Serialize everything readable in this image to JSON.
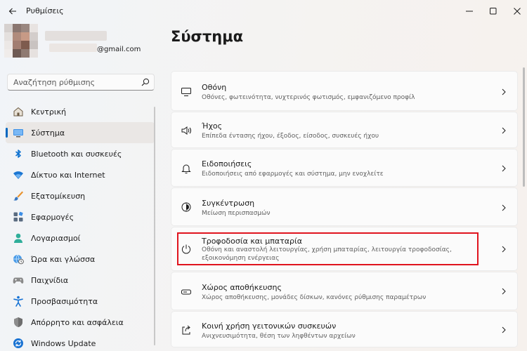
{
  "window": {
    "title": "Ρυθμίσεις"
  },
  "profile": {
    "email": "@gmail.com"
  },
  "search": {
    "placeholder": "Αναζήτηση ρύθμισης"
  },
  "sidebar": {
    "items": [
      {
        "label": "Κεντρική",
        "icon": "home-icon"
      },
      {
        "label": "Σύστημα",
        "icon": "system-icon",
        "active": true
      },
      {
        "label": "Bluetooth και συσκευές",
        "icon": "bluetooth-icon"
      },
      {
        "label": "Δίκτυο και Internet",
        "icon": "wifi-icon"
      },
      {
        "label": "Εξατομίκευση",
        "icon": "brush-icon"
      },
      {
        "label": "Εφαρμογές",
        "icon": "apps-icon"
      },
      {
        "label": "Λογαριασμοί",
        "icon": "person-icon"
      },
      {
        "label": "Ώρα και γλώσσα",
        "icon": "globe-clock-icon"
      },
      {
        "label": "Παιχνίδια",
        "icon": "gamepad-icon"
      },
      {
        "label": "Προσβασιμότητα",
        "icon": "accessibility-icon"
      },
      {
        "label": "Απόρρητο και ασφάλεια",
        "icon": "shield-icon"
      },
      {
        "label": "Windows Update",
        "icon": "update-icon"
      }
    ]
  },
  "main": {
    "title": "Σύστημα",
    "cards": [
      {
        "title": "Οθόνη",
        "subtitle": "Οθόνες, φωτεινότητα, νυχτερινός φωτισμός, εμφανιζόμενο προφίλ",
        "icon": "display-icon"
      },
      {
        "title": "Ήχος",
        "subtitle": "Επίπεδα έντασης ήχου, έξοδος, είσοδος, συσκευές ήχου",
        "icon": "speaker-icon"
      },
      {
        "title": "Ειδοποιήσεις",
        "subtitle": "Ειδοποιήσεις από εφαρμογές και σύστημα, μην ενοχλείτε",
        "icon": "bell-icon"
      },
      {
        "title": "Συγκέντρωση",
        "subtitle": "Μείωση περισπασμών",
        "icon": "focus-icon"
      },
      {
        "title": "Τροφοδοσία και μπαταρία",
        "subtitle": "Οθόνη και αναστολή λειτουργίας, χρήση μπαταρίας, λειτουργία τροφοδοσίας, εξοικονόμηση ενέργειας",
        "icon": "power-icon"
      },
      {
        "title": "Χώρος αποθήκευσης",
        "subtitle": "Χώρος αποθήκευσης, μονάδες δίσκων, κανόνες ρύθμισης παραμέτρων",
        "icon": "storage-icon"
      },
      {
        "title": "Κοινή χρήση γειτονικών συσκευών",
        "subtitle": "Ανιχνευσιμότητα, θέση των ληφθέντων αρχείων",
        "icon": "share-icon"
      }
    ]
  },
  "colors": {
    "accent": "#0067c0",
    "highlight": "#e0141e"
  }
}
